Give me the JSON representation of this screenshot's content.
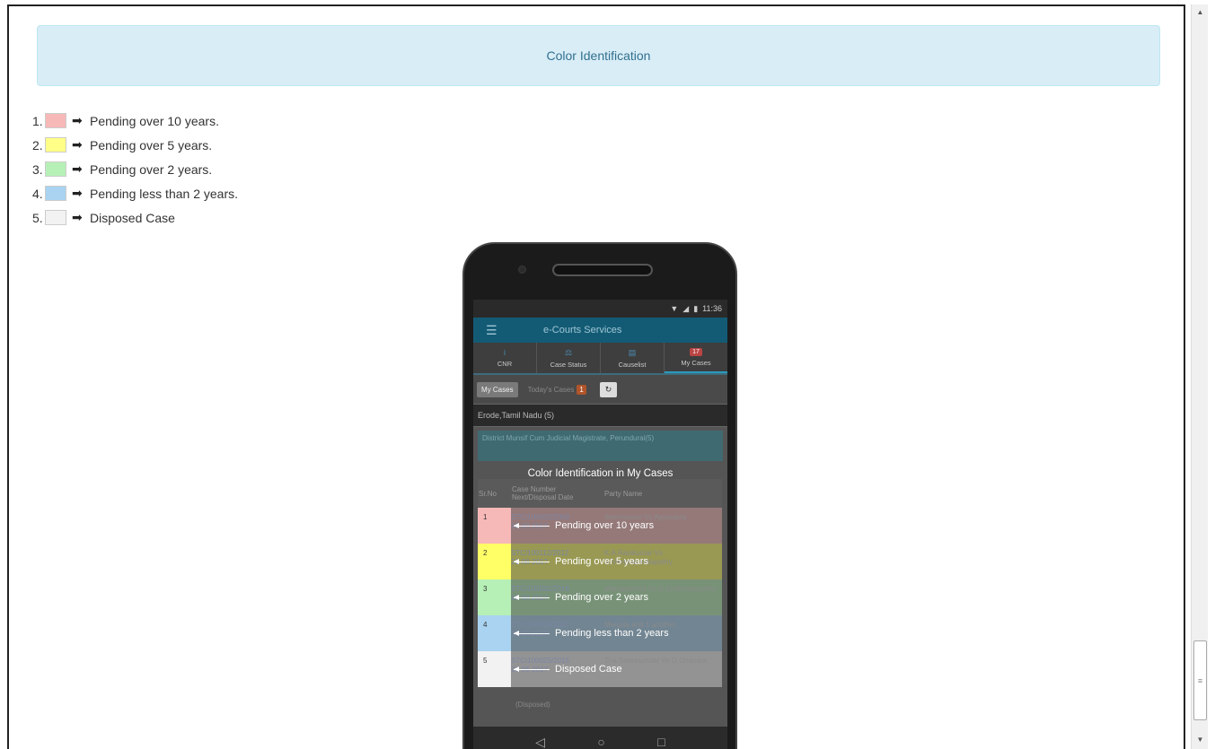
{
  "header": {
    "title": "Color Identification"
  },
  "legend": [
    {
      "num": "1.",
      "color": "#f7b8b8",
      "text": "Pending over 10 years."
    },
    {
      "num": "2.",
      "color": "#ffff88",
      "text": "Pending over 5 years."
    },
    {
      "num": "3.",
      "color": "#b6f0b6",
      "text": "Pending over 2 years."
    },
    {
      "num": "4.",
      "color": "#a9d3f0",
      "text": "Pending less than 2 years."
    },
    {
      "num": "5.",
      "color": "#f2f2f2",
      "text": "Disposed Case"
    }
  ],
  "arrow_icon": "arrow-right-icon",
  "phone": {
    "status_time": "11:36",
    "app_title": "e-Courts Services",
    "tabs": [
      {
        "label": "CNR",
        "icon": "info-icon"
      },
      {
        "label": "Case Status",
        "icon": "scales-icon"
      },
      {
        "label": "Causelist",
        "icon": "document-icon"
      },
      {
        "label": "My Cases",
        "badge": "17"
      }
    ],
    "subtabs": {
      "my_cases": "My Cases",
      "todays_cases": "Today's Cases",
      "todays_count": "1"
    },
    "location": "Erode,Tamil Nadu (5)",
    "court": "District Munsif Cum Judicial Magistrate, Perundurai(5)",
    "overlay_title": "Color Identification in My Cases",
    "table_headers": {
      "sr": "Sr.No",
      "case": "Case Number",
      "date": "Next/Disposal Date",
      "party": "Party Name"
    },
    "rows": [
      {
        "sr": "1",
        "color": "#f7b8b8",
        "case": "STC/100032/2009",
        "date": "28-09-2017",
        "party": "Seenivasan Vs Ayyasamy",
        "label": "Pending over 10 years"
      },
      {
        "sr": "2",
        "color": "#ffff66",
        "case": "STC/100112/2012",
        "date": "21-08-2017",
        "party": "K.A.Ravikumar Vs N.Venkatachalapathy",
        "label": "Pending over 5 years"
      },
      {
        "sr": "3",
        "color": "#b6f0b6",
        "case": "STC/100042/2016",
        "date": "28-09-2017",
        "party": "Management Vs D.Krishnamoorthy",
        "label": "Pending over 2 years"
      },
      {
        "sr": "4",
        "color": "#a9d3f0",
        "case": "STC/100016/2017",
        "date": "28-09-2017",
        "party": "Manjula and 1 another",
        "label": "Pending less than 2 years"
      },
      {
        "sr": "5",
        "color": "#f2f2f2",
        "case": "STC/100025/2015",
        "date": "29-06-2017",
        "party": "Tha.Somasundar Vs D.Chandra",
        "label": "Disposed Case"
      }
    ],
    "disposed_note": "(Disposed)"
  }
}
